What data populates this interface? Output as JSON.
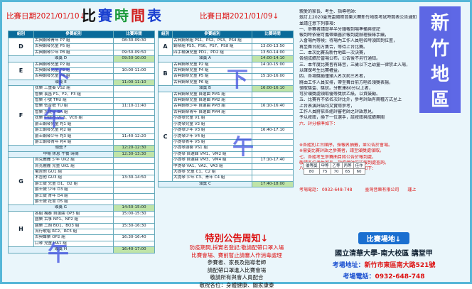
{
  "header": {
    "date_left": "比賽日期2021/01/10↓",
    "title_chars": [
      "比",
      "賽",
      "時",
      "間",
      "表"
    ],
    "title_colors": [
      "#111111",
      "#1a3fd0",
      "#1a9a3a",
      "#d12020",
      "#1a3fd0"
    ],
    "date_right": "比賽日期2021/01/09↓"
  },
  "table_headers": {
    "group": "組別",
    "category": "參賽組別",
    "time": "比賽時間"
  },
  "left_table": [
    {
      "group": "D",
      "rows": [
        {
          "cat": "古典鋼琴青年 P7 組",
          "time": "08:30-09:30"
        },
        {
          "cat": "古典鋼琴兒童 P5 組",
          "time": ""
        },
        {
          "cat": "古典鋼琴少年 P8 組",
          "time": "09:50-09:50"
        }
      ],
      "gap": {
        "label": "頒獎 D",
        "time": "09:50-10:00"
      }
    },
    {
      "group": "E",
      "rows": [
        {
          "cat": "古典鋼琴兒童 P2 組",
          "time": ""
        },
        {
          "cat": "古典鋼琴兒童 P3 組",
          "time": "10:00-11:00"
        },
        {
          "cat": "古典鋼琴兒童 P4 組",
          "time": ""
        }
      ],
      "gap": {
        "label": "頒獎 E",
        "time": "11:00-11:10"
      }
    },
    {
      "group": "F",
      "rows": [
        {
          "cat": "弦樂 三重奏 VS2 組",
          "time": ""
        },
        {
          "cat": "管樂 長笛 F1、F2、F3 組",
          "time": ""
        },
        {
          "cat": "管樂 小號 TRU 組",
          "time": ""
        },
        {
          "cat": "管樂 低音號 TU 組",
          "time": "11:10-11:40"
        },
        {
          "cat": "管樂 大提琴 BA 組",
          "time": ""
        },
        {
          "cat": "弦樂 中提琴 VC3、VC6 組",
          "time": ""
        },
        {
          "cat": "爵士鋼琴兒童 PJ1 組",
          "time": ""
        },
        {
          "cat": "爵士鋼琴兒童 PJ2 組",
          "time": ""
        },
        {
          "cat": "爵士鋼琴少年 PJ3 組",
          "time": "11:40-12:20"
        },
        {
          "cat": "爵士鋼琴青年 PJ4 組",
          "time": ""
        }
      ],
      "gap": {
        "label": "頒獎 F",
        "time": "12:20-12:30"
      }
    },
    {
      "group": "",
      "rows": [],
      "gap": {
        "label": "中場 休息 午餐 時間",
        "time": "12:30-13:30"
      }
    },
    {
      "group": "G",
      "rows": [
        {
          "cat": "烏克麗麗 少年 UK2 組",
          "time": ""
        },
        {
          "cat": "烏克麗麗 兒童 UK1 組",
          "time": ""
        },
        {
          "cat": "電吉他 GU1 組",
          "time": ""
        },
        {
          "cat": "木吉他 GU3 組",
          "time": "13:30-14:50"
        },
        {
          "cat": "爵士鼓 兒童 D1、D2 組",
          "time": ""
        },
        {
          "cat": "爵士鼓 少年 D3 組",
          "time": ""
        },
        {
          "cat": "爵士鼓 青年 D4 組",
          "time": ""
        },
        {
          "cat": "爵士鼓 社會 D5 組",
          "time": ""
        }
      ],
      "gap": {
        "label": "頒獎 G",
        "time": "14:50-15:00"
      }
    },
    {
      "group": "H",
      "rows": [
        {
          "cat": "各組 獨奏 自選曲 OP3 組",
          "time": "15:00-15:30"
        },
        {
          "cat": "國樂 古箏 NP1、NP2 組",
          "time": ""
        },
        {
          "cat": "國樂 二胡 BO1、BO3 組",
          "time": "15:30-16:30"
        },
        {
          "cat": "流行歌唱 RC2、RC5 組",
          "time": ""
        },
        {
          "cat": "古典聲樂 OP2 組",
          "time": "16:30-16:40"
        },
        {
          "cat": "口琴 兒童 HA1 組",
          "time": ""
        }
      ],
      "gap": {
        "label": "頒獎 H",
        "time": "16:40-17:00"
      }
    }
  ],
  "right_table": [
    {
      "group": "A",
      "rows": [
        {
          "cat": "古典鋼琴組 PS1、PS2、PS3、PS4 組",
          "time": ""
        },
        {
          "cat": "鋼琴組 PS5、PS6、PS7、PS8 組",
          "time": "13:00-13:50"
        },
        {
          "cat": "四手聯彈兒童 PD1、PD2 組",
          "time": "13:50-14:00"
        }
      ],
      "gap": {
        "label": "頒獎 A",
        "time": "14:00-14:10"
      }
    },
    {
      "group": "B",
      "rows": [
        {
          "cat": "古典鋼琴兒童 P2 組",
          "time": "14:10-15:00"
        },
        {
          "cat": "古典鋼琴兒童 P4 組",
          "time": ""
        },
        {
          "cat": "古典鋼琴兒童 P5 組",
          "time": "15:10-16:00"
        },
        {
          "cat": "古典鋼琴兒童 P6 組",
          "time": ""
        }
      ],
      "gap": {
        "label": "頒獎 B",
        "time": "16:00-16:10"
      }
    },
    {
      "group": "C",
      "rows": [
        {
          "cat": "古典鋼琴兒童 自選曲 PM1 組",
          "time": ""
        },
        {
          "cat": "古典鋼琴兒童 自選曲 PM2 組",
          "time": ""
        },
        {
          "cat": "古典鋼琴少年 自選曲 PM3 組",
          "time": "16:10-16:40"
        },
        {
          "cat": "古典鋼琴青年 自選曲 PM4 組",
          "time": ""
        },
        {
          "cat": "小提琴兒童 V1 組",
          "time": ""
        },
        {
          "cat": "小提琴兒童 V2 組",
          "time": ""
        },
        {
          "cat": "小提琴少年 V3 組",
          "time": "16:40-17:10"
        },
        {
          "cat": "小提琴少年 V4 組",
          "time": ""
        },
        {
          "cat": "小提琴青年 V5 組",
          "time": ""
        },
        {
          "cat": "小提琴演奏 VS1 組",
          "time": ""
        },
        {
          "cat": "小提琴 自選曲 VM1、VM2 組",
          "time": ""
        },
        {
          "cat": "小提琴 自選曲 VM3、VM4 組",
          "time": "17:10-17:40"
        },
        {
          "cat": "中提琴 VA1、VA2、VA3 組",
          "time": ""
        },
        {
          "cat": "大提琴 兒童 C1、C2 組",
          "time": ""
        },
        {
          "cat": "大提琴 少年 C3、青年 C4 組",
          "time": ""
        }
      ],
      "gap": {
        "label": "頒獎 C",
        "time": "17:40-18:00"
      }
    }
  ],
  "overlays": {
    "left_top": "下",
    "left_mid": "午",
    "left_bot": "午",
    "center_top": "下",
    "center_bot": "午"
  },
  "notice": {
    "title": "特別公告周知↓",
    "lines": [
      "防疫期間,採實名登記;敬請配帶口罩入場",
      "比賽會場、賽前暫止請審人作消毒處理",
      "參賽者、家長及指導老師",
      "請配帶口罩進入比賽會場",
      "敬請所有與會人員配合",
      "敬祝各位：身體健康、闔家康泰"
    ]
  },
  "right_panel": {
    "intro": [
      "親愛的家長、考生、指導老師：",
      "茲訂上2020臺灣盃國際音樂大賽新竹地區考試時間表公告通知",
      "並請注意下列事項："
    ],
    "items": [
      "一、參賽者請提早半分鐘報到場準備與登記",
      "報到時依需可攜帶樂器於報到處辦理檢錄手續，",
      "入會場內等候；待場內工作人員唱名時須回到位置，",
      "再至舞台前方集合，等待上台比賽。",
      "二、本次比賽為新竹地區一次決賽，",
      "各組成績於當場公布，公告後不另行通知。",
      "三、本年度比賽皆有錄音，三歲以下之幼童一律禁止入場，",
      "以確保考生比賽權益。",
      "四、各項獎勵僅頒入名次前三名者，",
      "將由工作人員安排，帶至舞台前方唱名領獎表揚，",
      "領取獎盃、獎狀。分數達80分以上者，",
      "可於頒獎處領取優等獎狀乙紙，以資鼓勵。",
      "五、比賽有不依名次評比外，參考評語有兩種方式呈上",
      "上台表演評語均又實際參考，",
      "工作人員將依各組評審老師之評語意見，",
      "予以按鈕，換下一位選手，該按鈕與成績無關",
      "六、評分標準如下：",
      "※各組別上台順序，採報名抽籤，並公告於會場。",
      "※需要比賽評語之參賽者，請至頒獎處領取。",
      "七、各組考生參賽曲目將公告於報到處，",
      "敬請各位考生家長、指導老師前往報到處查詢。",
      "八、考場地址及考場電話聯絡電話如下："
    ],
    "score_header": [
      "優等獎",
      "甲等",
      "乙等",
      "丙等",
      "佳作"
    ],
    "score_row": [
      "80",
      "75",
      "70",
      "65",
      "60"
    ],
    "contact": "考場電話： 0932-648-748　　　臺灣音樂有限公司　　謹上",
    "stamp_text": [
      "新",
      "竹",
      "地",
      "區"
    ]
  },
  "venue": {
    "title": "比賽場地↓",
    "name": "國立清華大學-南大校區 講堂甲",
    "address_label": "考場地址：",
    "address": "新竹市東區南大路521號",
    "phone_label": "考場電話：",
    "phone": "0932-648-748"
  }
}
